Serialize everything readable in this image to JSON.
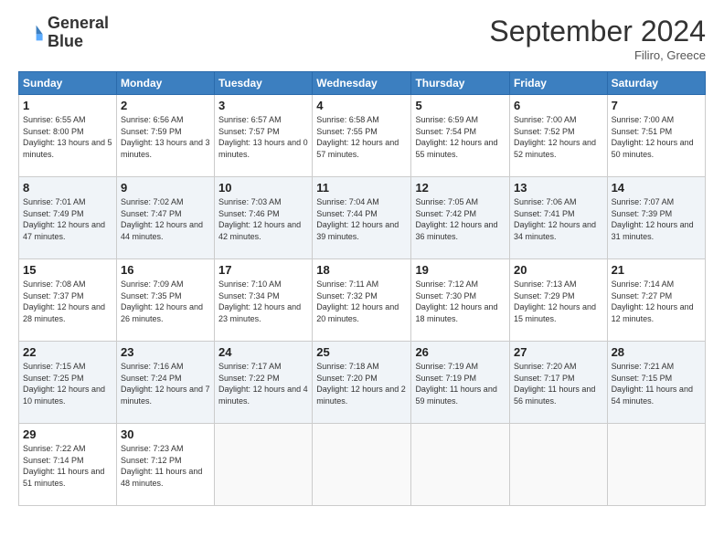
{
  "logo": {
    "line1": "General",
    "line2": "Blue"
  },
  "title": "September 2024",
  "location": "Filiro, Greece",
  "days_of_week": [
    "Sunday",
    "Monday",
    "Tuesday",
    "Wednesday",
    "Thursday",
    "Friday",
    "Saturday"
  ],
  "weeks": [
    [
      {
        "day": "1",
        "sunrise": "6:55 AM",
        "sunset": "8:00 PM",
        "daylight": "13 hours and 5 minutes."
      },
      {
        "day": "2",
        "sunrise": "6:56 AM",
        "sunset": "7:59 PM",
        "daylight": "13 hours and 3 minutes."
      },
      {
        "day": "3",
        "sunrise": "6:57 AM",
        "sunset": "7:57 PM",
        "daylight": "13 hours and 0 minutes."
      },
      {
        "day": "4",
        "sunrise": "6:58 AM",
        "sunset": "7:55 PM",
        "daylight": "12 hours and 57 minutes."
      },
      {
        "day": "5",
        "sunrise": "6:59 AM",
        "sunset": "7:54 PM",
        "daylight": "12 hours and 55 minutes."
      },
      {
        "day": "6",
        "sunrise": "7:00 AM",
        "sunset": "7:52 PM",
        "daylight": "12 hours and 52 minutes."
      },
      {
        "day": "7",
        "sunrise": "7:00 AM",
        "sunset": "7:51 PM",
        "daylight": "12 hours and 50 minutes."
      }
    ],
    [
      {
        "day": "8",
        "sunrise": "7:01 AM",
        "sunset": "7:49 PM",
        "daylight": "12 hours and 47 minutes."
      },
      {
        "day": "9",
        "sunrise": "7:02 AM",
        "sunset": "7:47 PM",
        "daylight": "12 hours and 44 minutes."
      },
      {
        "day": "10",
        "sunrise": "7:03 AM",
        "sunset": "7:46 PM",
        "daylight": "12 hours and 42 minutes."
      },
      {
        "day": "11",
        "sunrise": "7:04 AM",
        "sunset": "7:44 PM",
        "daylight": "12 hours and 39 minutes."
      },
      {
        "day": "12",
        "sunrise": "7:05 AM",
        "sunset": "7:42 PM",
        "daylight": "12 hours and 36 minutes."
      },
      {
        "day": "13",
        "sunrise": "7:06 AM",
        "sunset": "7:41 PM",
        "daylight": "12 hours and 34 minutes."
      },
      {
        "day": "14",
        "sunrise": "7:07 AM",
        "sunset": "7:39 PM",
        "daylight": "12 hours and 31 minutes."
      }
    ],
    [
      {
        "day": "15",
        "sunrise": "7:08 AM",
        "sunset": "7:37 PM",
        "daylight": "12 hours and 28 minutes."
      },
      {
        "day": "16",
        "sunrise": "7:09 AM",
        "sunset": "7:35 PM",
        "daylight": "12 hours and 26 minutes."
      },
      {
        "day": "17",
        "sunrise": "7:10 AM",
        "sunset": "7:34 PM",
        "daylight": "12 hours and 23 minutes."
      },
      {
        "day": "18",
        "sunrise": "7:11 AM",
        "sunset": "7:32 PM",
        "daylight": "12 hours and 20 minutes."
      },
      {
        "day": "19",
        "sunrise": "7:12 AM",
        "sunset": "7:30 PM",
        "daylight": "12 hours and 18 minutes."
      },
      {
        "day": "20",
        "sunrise": "7:13 AM",
        "sunset": "7:29 PM",
        "daylight": "12 hours and 15 minutes."
      },
      {
        "day": "21",
        "sunrise": "7:14 AM",
        "sunset": "7:27 PM",
        "daylight": "12 hours and 12 minutes."
      }
    ],
    [
      {
        "day": "22",
        "sunrise": "7:15 AM",
        "sunset": "7:25 PM",
        "daylight": "12 hours and 10 minutes."
      },
      {
        "day": "23",
        "sunrise": "7:16 AM",
        "sunset": "7:24 PM",
        "daylight": "12 hours and 7 minutes."
      },
      {
        "day": "24",
        "sunrise": "7:17 AM",
        "sunset": "7:22 PM",
        "daylight": "12 hours and 4 minutes."
      },
      {
        "day": "25",
        "sunrise": "7:18 AM",
        "sunset": "7:20 PM",
        "daylight": "12 hours and 2 minutes."
      },
      {
        "day": "26",
        "sunrise": "7:19 AM",
        "sunset": "7:19 PM",
        "daylight": "11 hours and 59 minutes."
      },
      {
        "day": "27",
        "sunrise": "7:20 AM",
        "sunset": "7:17 PM",
        "daylight": "11 hours and 56 minutes."
      },
      {
        "day": "28",
        "sunrise": "7:21 AM",
        "sunset": "7:15 PM",
        "daylight": "11 hours and 54 minutes."
      }
    ],
    [
      {
        "day": "29",
        "sunrise": "7:22 AM",
        "sunset": "7:14 PM",
        "daylight": "11 hours and 51 minutes."
      },
      {
        "day": "30",
        "sunrise": "7:23 AM",
        "sunset": "7:12 PM",
        "daylight": "11 hours and 48 minutes."
      },
      null,
      null,
      null,
      null,
      null
    ]
  ]
}
